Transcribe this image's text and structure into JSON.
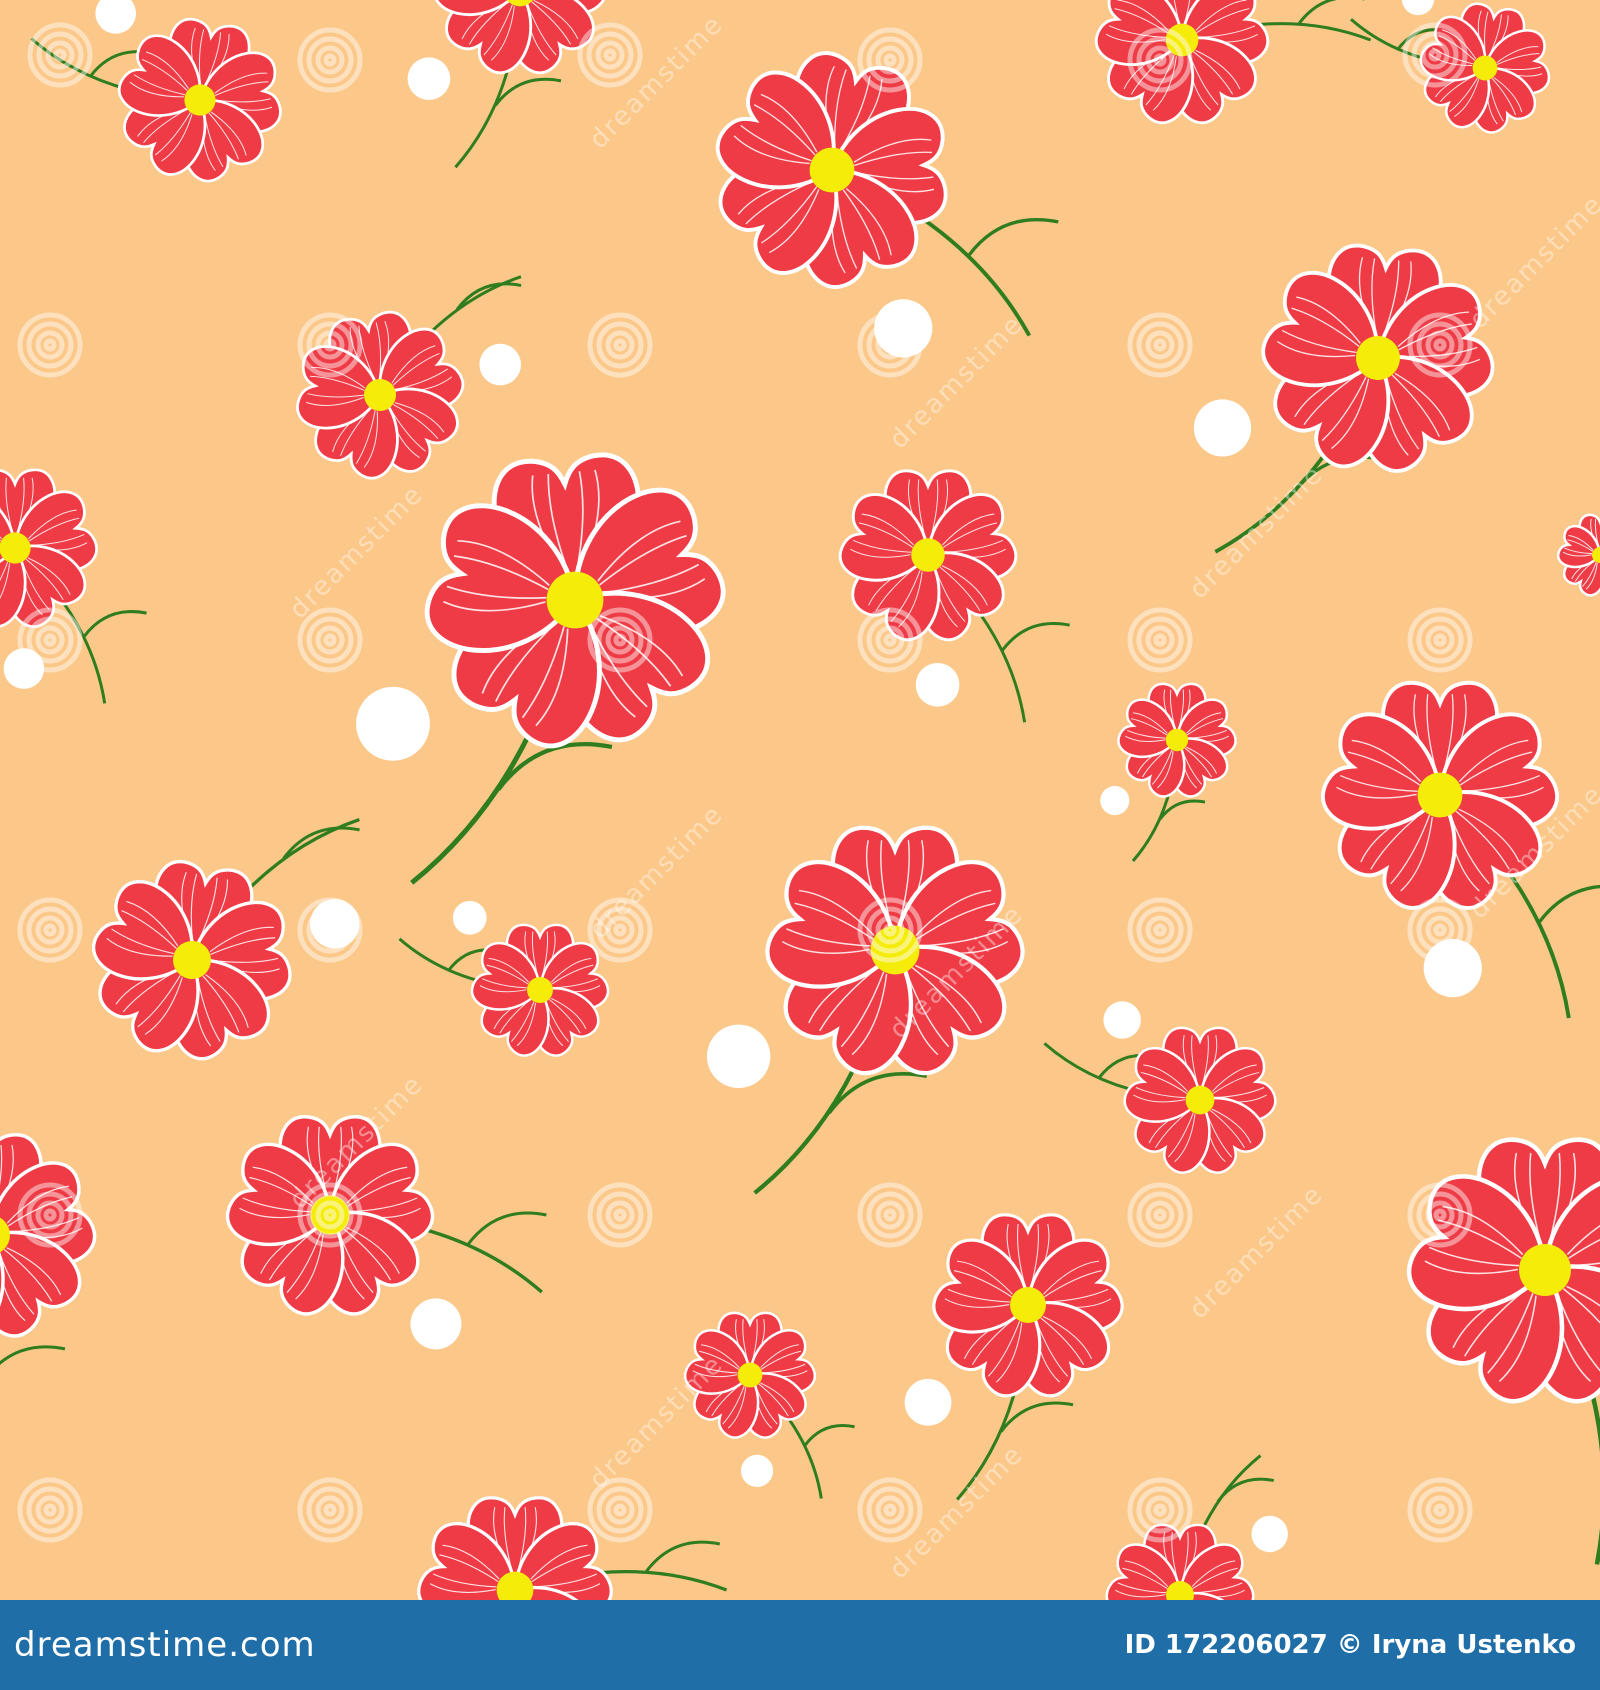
{
  "image": {
    "description_icon": "floral-pattern-image",
    "colors": {
      "background": "#fcc889",
      "petal": "#ef3b46",
      "petal_outline": "#ffffff",
      "center": "#f5ec0a",
      "stem": "#2f7d1f",
      "berry": "#ffffff",
      "footer": "#1f6ea7",
      "watermark": "#ffffff"
    }
  },
  "watermark": {
    "text": "dreamstime",
    "icon": "spiral-watermark-icon"
  },
  "footer": {
    "site": "dreamstime.com",
    "id_label": "ID 172206027 © Iryna Ustenko"
  }
}
